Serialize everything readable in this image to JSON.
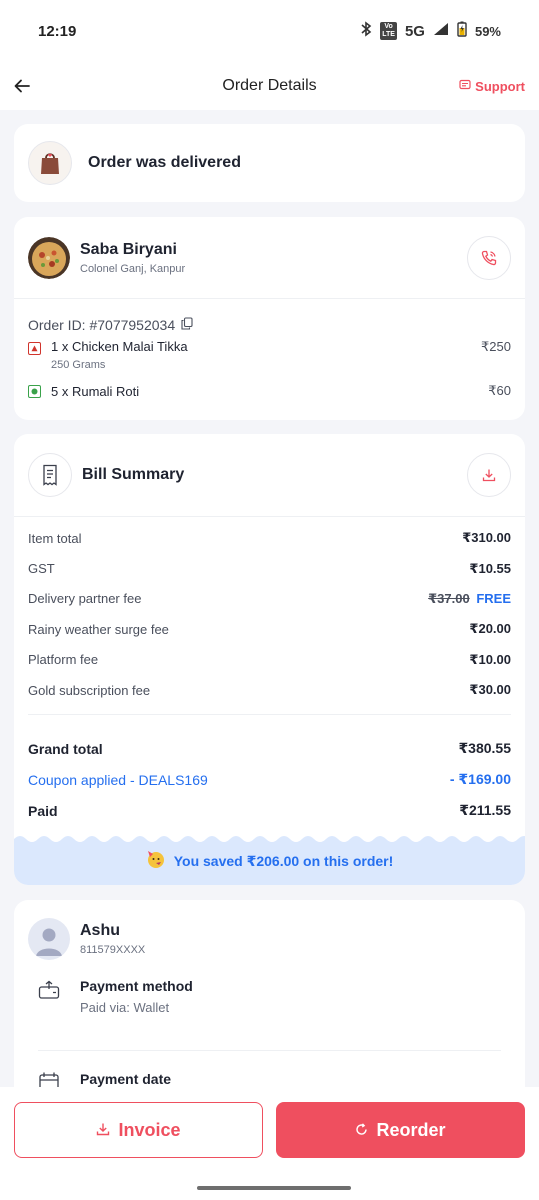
{
  "status_bar": {
    "time": "12:19",
    "lte": "Vo\nLTE",
    "network": "5G",
    "battery": "59%"
  },
  "header": {
    "title": "Order Details",
    "support": "Support"
  },
  "status_card": {
    "message": "Order was delivered"
  },
  "restaurant": {
    "name": "Saba Biryani",
    "location": "Colonel Ganj, Kanpur",
    "order_id": "Order ID: #7077952034",
    "items": [
      {
        "name": "1 x Chicken Malai Tikka",
        "detail": "250 Grams",
        "price": "₹250",
        "type": "non-veg"
      },
      {
        "name": "5 x Rumali Roti",
        "detail": "",
        "price": "₹60",
        "type": "veg"
      }
    ]
  },
  "bill": {
    "title": "Bill Summary",
    "rows": [
      {
        "label": "Item total",
        "amount": "₹310.00"
      },
      {
        "label": "GST",
        "amount": "₹10.55"
      },
      {
        "label": "Delivery partner fee",
        "amount_struck": "₹37.00",
        "amount": "FREE"
      },
      {
        "label": "Rainy weather surge fee",
        "amount": "₹20.00"
      },
      {
        "label": "Platform fee",
        "amount": "₹10.00"
      },
      {
        "label": "Gold subscription fee",
        "amount": "₹30.00"
      }
    ],
    "grand_total_label": "Grand total",
    "grand_total": "₹380.55",
    "coupon_label": "Coupon applied - DEALS169",
    "coupon_amount": "- ₹169.00",
    "paid_label": "Paid",
    "paid_amount": "₹211.55",
    "savings": "You saved ₹206.00 on this order!"
  },
  "customer": {
    "name": "Ashu",
    "phone": "811579XXXX",
    "payment_method_label": "Payment method",
    "payment_method_value": "Paid via: Wallet",
    "payment_date_label": "Payment date"
  },
  "actions": {
    "invoice": "Invoice",
    "reorder": "Reorder"
  },
  "colors": {
    "accent": "#ef4f5f",
    "blue": "#256fef",
    "savings_bg": "#dbe8fd"
  }
}
